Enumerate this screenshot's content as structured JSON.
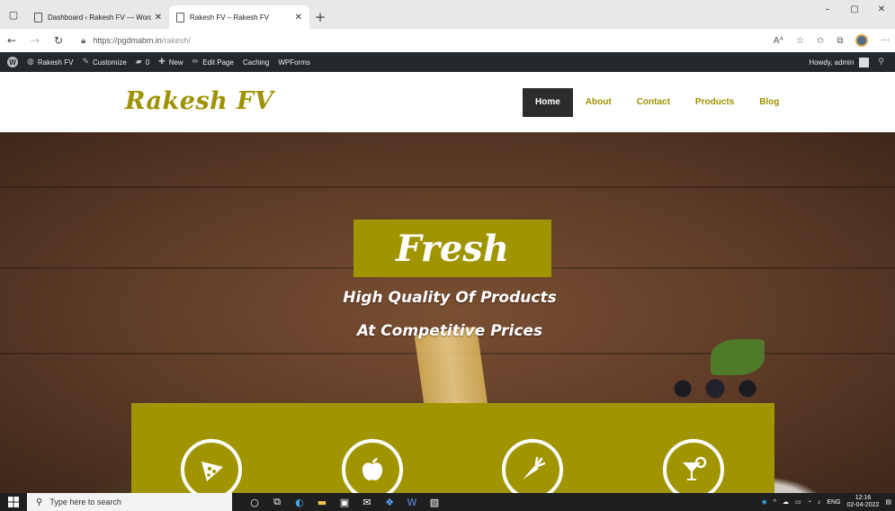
{
  "browser": {
    "tabs": [
      {
        "title": "Dashboard ‹ Rakesh FV — Word",
        "active": false
      },
      {
        "title": "Rakesh FV – Rakesh FV",
        "active": true
      }
    ],
    "url_host": "https://pgdmabm.in",
    "url_path": "/rakesh/",
    "read_aloud_label": "Aᴬ"
  },
  "adminbar": {
    "site_name": "Rakesh FV",
    "customize": "Customize",
    "comments_count": "0",
    "new": "New",
    "edit_page": "Edit Page",
    "caching": "Caching",
    "wpforms": "WPForms",
    "howdy": "Howdy, admin"
  },
  "site": {
    "brand": "Rakesh FV",
    "nav": [
      {
        "label": "Home",
        "current": true
      },
      {
        "label": "About",
        "current": false
      },
      {
        "label": "Contact",
        "current": false
      },
      {
        "label": "Products",
        "current": false
      },
      {
        "label": "Blog",
        "current": false
      }
    ]
  },
  "hero": {
    "title": "Fresh",
    "subtitle_line1": "High Quality Of Products",
    "subtitle_line2": "At Competitive Prices",
    "features": [
      {
        "icon": "pizza-icon"
      },
      {
        "icon": "apple-icon"
      },
      {
        "icon": "carrot-icon"
      },
      {
        "icon": "cocktail-icon"
      }
    ]
  },
  "taskbar": {
    "search_placeholder": "Type here to search",
    "language": "ENG",
    "time": "12:16",
    "date": "02-04-2022"
  },
  "colors": {
    "accent": "#a09500",
    "brand_text": "#9e9200",
    "admin_bar": "#23282d",
    "nav_current_bg": "#2c2c2c"
  }
}
